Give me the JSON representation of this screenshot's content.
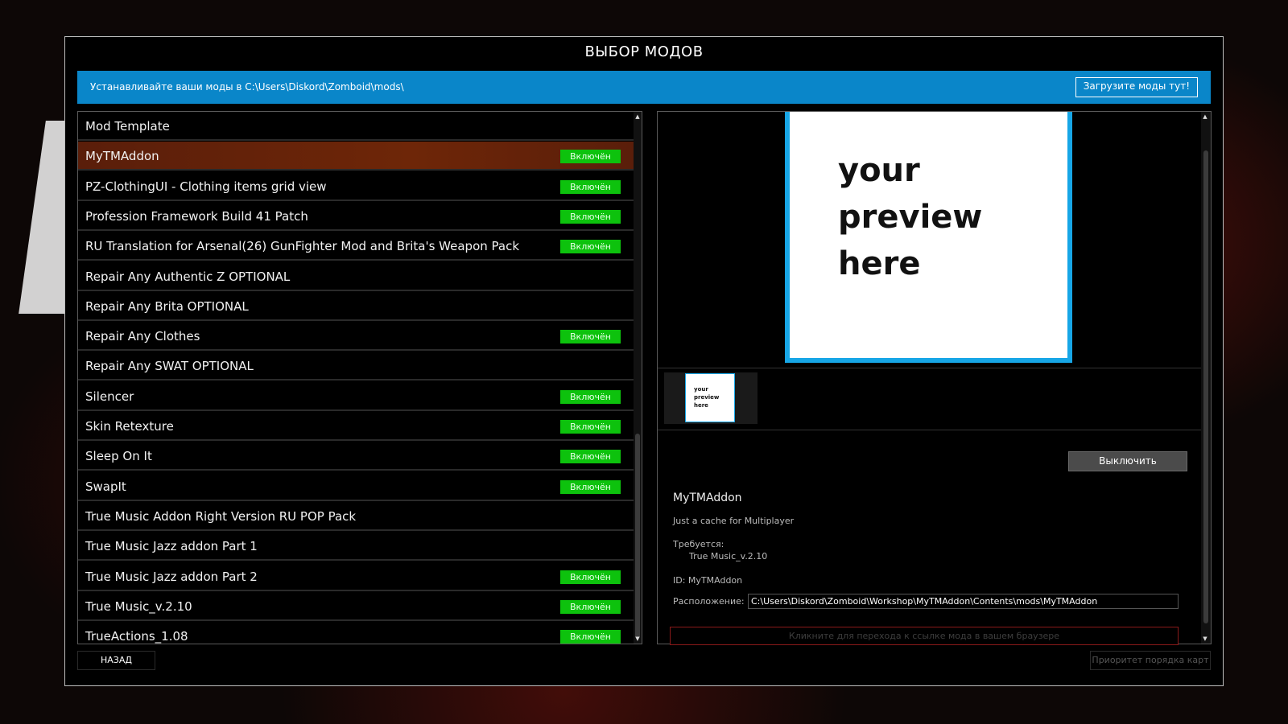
{
  "window": {
    "title": "ВЫБОР МОДОВ",
    "info_text": "Устанавливайте ваши моды в C:\\Users\\Diskord\\Zomboid\\mods\\",
    "upload_button": "Загрузите моды тут!"
  },
  "mods": [
    {
      "name": "Mod Template",
      "status": ""
    },
    {
      "name": "MyTMAddon",
      "status": "Включён",
      "selected": true
    },
    {
      "name": "PZ-ClothingUI - Clothing items grid view",
      "status": "Включён"
    },
    {
      "name": "Profession Framework Build 41 Patch",
      "status": "Включён"
    },
    {
      "name": "RU Translation for Arsenal(26) GunFighter Mod and Brita's Weapon Pack",
      "status": "Включён"
    },
    {
      "name": "Repair Any Authentic Z OPTIONAL",
      "status": ""
    },
    {
      "name": "Repair Any Brita OPTIONAL",
      "status": ""
    },
    {
      "name": "Repair Any Clothes",
      "status": "Включён"
    },
    {
      "name": "Repair Any SWAT OPTIONAL",
      "status": ""
    },
    {
      "name": "Silencer",
      "status": "Включён"
    },
    {
      "name": "Skin Retexture",
      "status": "Включён"
    },
    {
      "name": "Sleep On It",
      "status": "Включён"
    },
    {
      "name": "SwapIt",
      "status": "Включён"
    },
    {
      "name": "True Music Addon Right Version RU POP Pack",
      "status": ""
    },
    {
      "name": "True Music Jazz addon Part 1",
      "status": ""
    },
    {
      "name": "True Music Jazz addon Part 2",
      "status": "Включён"
    },
    {
      "name": "True Music_v.2.10",
      "status": "Включён"
    },
    {
      "name": "TrueActions_1.08",
      "status": "Включён"
    }
  ],
  "detail": {
    "preview_text": "your preview here",
    "thumb_text": "your preview here",
    "disable_button": "Выключить",
    "name": "MyTMAddon",
    "description": "Just a cache for Multiplayer",
    "requires_label": "Требуется:",
    "requires_value": "True Music_v.2.10",
    "id": "ID: MyTMAddon",
    "location_label": "Расположение:",
    "location_value": "C:\\Users\\Diskord\\Zomboid\\Workshop\\MyTMAddon\\Contents\\mods\\MyTMAddon",
    "link_button": "Кликните для перехода к ссылке мода в вашем браузере"
  },
  "footer": {
    "back_button": "НАЗАД",
    "priority_button": "Приоритет порядка карт"
  },
  "colors": {
    "accent_blue": "#0a86c9",
    "enabled_green": "#0dc20d",
    "selected_row": "#6e2608",
    "link_border": "#8a1a1a"
  },
  "icons": {
    "scroll_up": "▲",
    "scroll_down": "▼"
  }
}
